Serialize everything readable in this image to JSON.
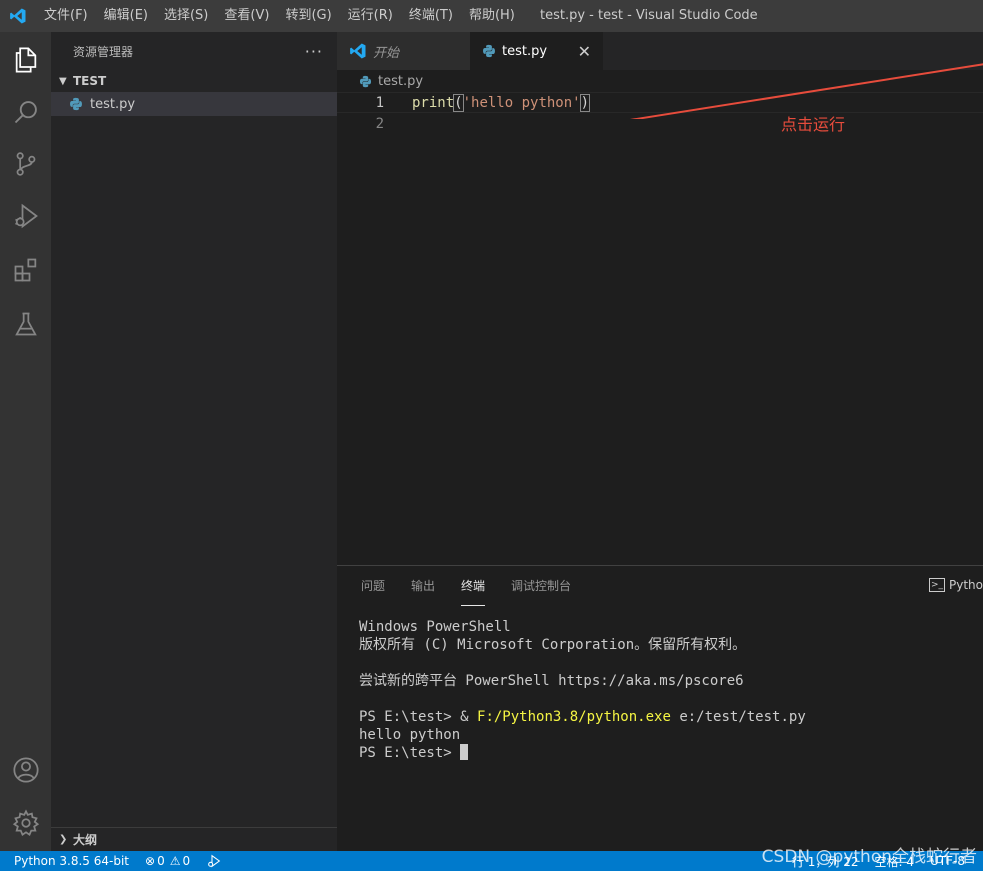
{
  "titlebar": {
    "window_title": "test.py - test - Visual Studio Code",
    "menu": [
      "文件(F)",
      "编辑(E)",
      "选择(S)",
      "查看(V)",
      "转到(G)",
      "运行(R)",
      "终端(T)",
      "帮助(H)"
    ]
  },
  "sidebar": {
    "title": "资源管理器",
    "more": "···",
    "folder": "TEST",
    "files": [
      "test.py"
    ],
    "outline": "大纲"
  },
  "editor": {
    "tabs": [
      {
        "label": "开始"
      },
      {
        "label": "test.py"
      }
    ],
    "breadcrumb": "test.py",
    "lines": [
      {
        "num": "1",
        "fn": "print",
        "open": "(",
        "str": "'hello python'",
        "close": ")"
      },
      {
        "num": "2"
      }
    ],
    "annotation": "点击运行"
  },
  "panel": {
    "tabs": [
      "问题",
      "输出",
      "终端",
      "调试控制台"
    ],
    "active_tab": "终端",
    "terminal_picker": "Pytho",
    "terminal": {
      "l1": "Windows PowerShell",
      "l2": "版权所有 (C) Microsoft Corporation。保留所有权利。",
      "l3": "尝试新的跨平台 PowerShell https://aka.ms/pscore6",
      "l4_prompt": "PS E:\\test> & ",
      "l4_exe": "F:/Python3.8/python.exe",
      "l4_arg": " e:/test/test.py",
      "l5": "hello python",
      "l6_prompt": "PS E:\\test> "
    }
  },
  "statusbar": {
    "python": "Python 3.8.5 64-bit",
    "errors": "0",
    "warnings": "0",
    "position": "行 1，列 22",
    "spaces": "空格: 4",
    "encoding": "UTF-8"
  },
  "watermark": "CSDN @python全栈蛇行者",
  "colors": {
    "accent": "#007acc",
    "annotation": "#e74c3c",
    "activity_icon": "#858585",
    "activity_icon_active": "#ffffff"
  }
}
